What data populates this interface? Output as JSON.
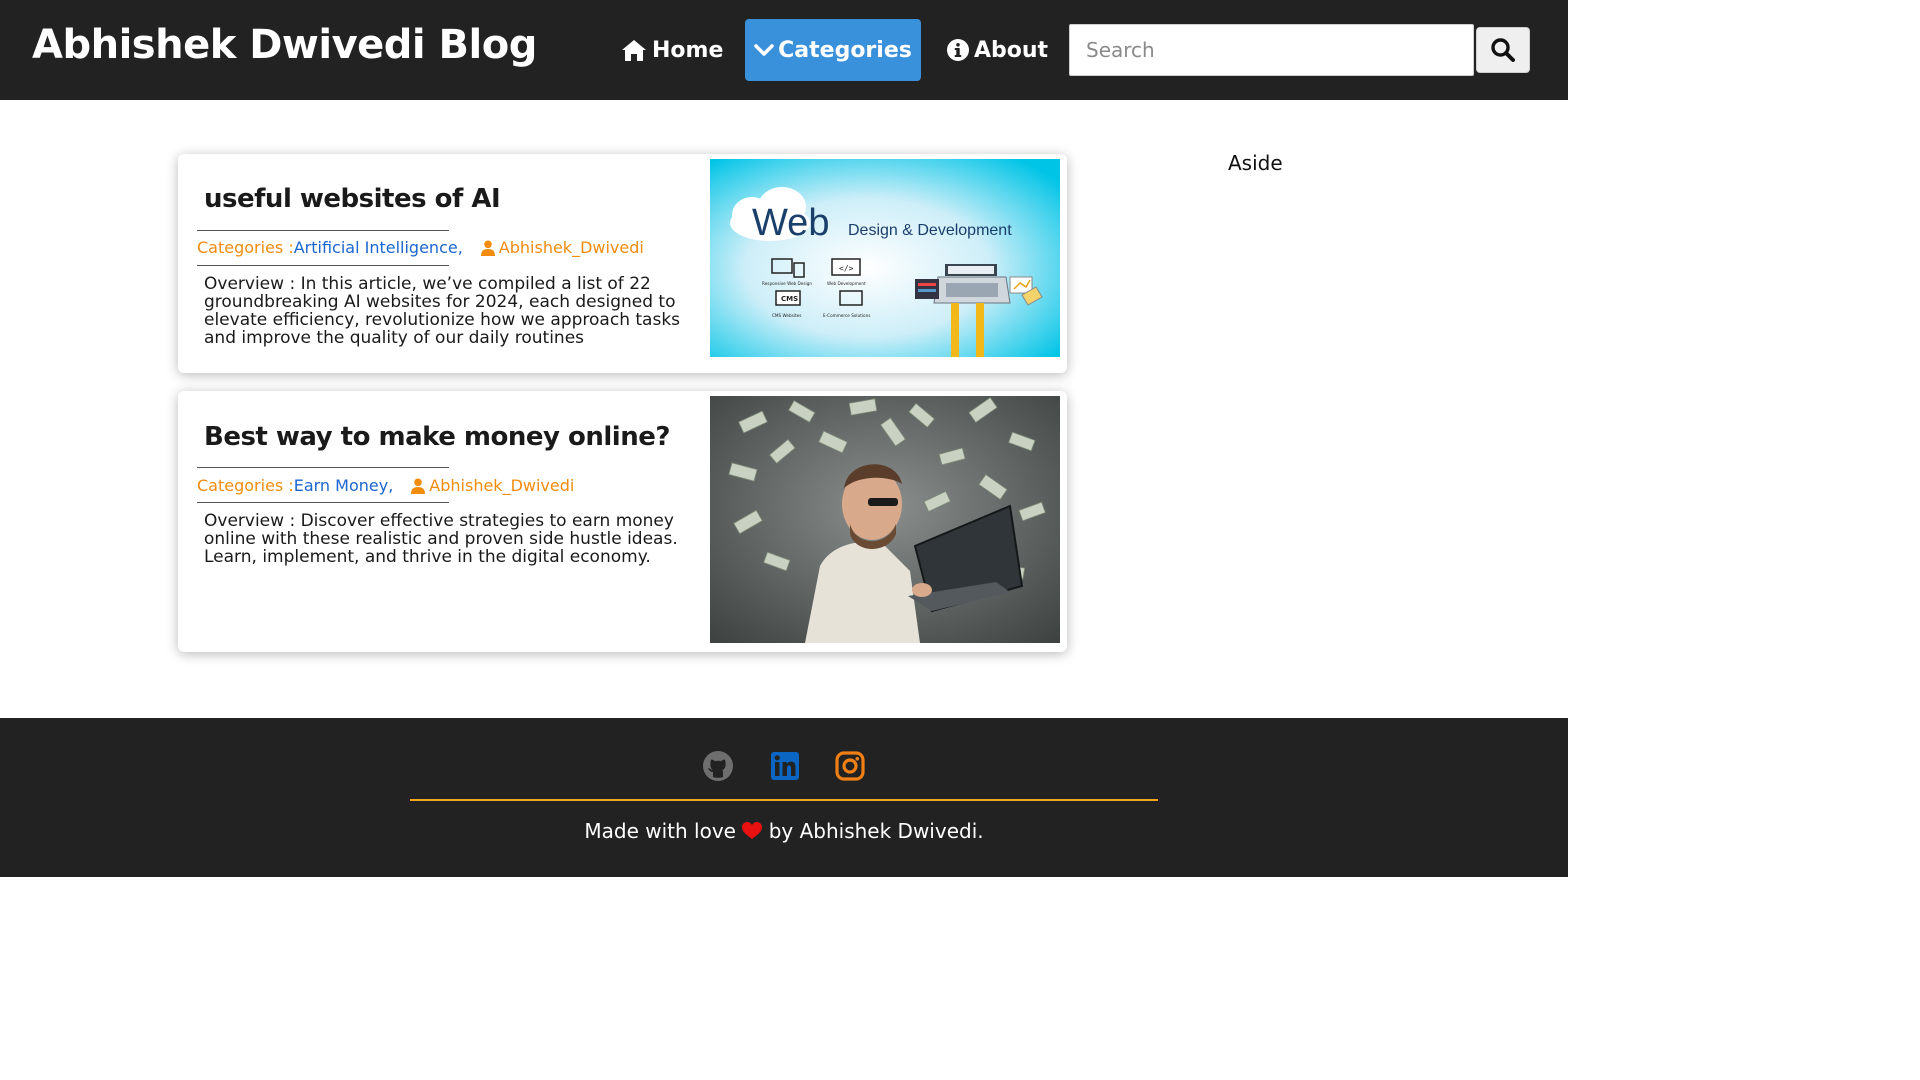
{
  "header": {
    "brand": "Abhishek Dwivedi Blog",
    "nav": {
      "home": "Home",
      "categories": "Categories",
      "about": "About"
    },
    "search_placeholder": "Search"
  },
  "posts": [
    {
      "title": "useful websites of AI",
      "categories_label": "Categories :",
      "category": "Artificial Intelligence,",
      "author": "Abhishek_Dwivedi",
      "overview": "Overview : In this article, we’ve compiled a list of 22 groundbreaking AI websites for 2024, each designed to elevate efficiency, revolutionize how we approach tasks and improve the quality of our daily routines",
      "image": {
        "heading": "Web",
        "subheading": "Design & Development",
        "labels": [
          "Responsive Web Design",
          "Web Development",
          "CMS Websites",
          "E-Commerce Solutions"
        ],
        "cms_text": "CMS",
        "code_text": "</>"
      }
    },
    {
      "title": "Best way to make money online?",
      "categories_label": "Categories :",
      "category": "Earn Money,",
      "author": "Abhishek_Dwivedi",
      "overview": "Overview : Discover effective strategies to earn money online with these realistic and proven side hustle ideas. Learn, implement, and thrive in the digital economy."
    }
  ],
  "aside": "Aside",
  "footer": {
    "credit_before": "Made with love",
    "credit_after": "by Abhishek Dwivedi.",
    "icons": [
      "github-icon",
      "linkedin-icon",
      "instagram-icon",
      "heart-icon"
    ]
  },
  "colors": {
    "header_bg": "#222222",
    "active_nav": "#3a91db",
    "meta_orange": "#f28c0f",
    "link_blue": "#1a66d0",
    "footer_rule": "#f0a91f",
    "linkedin_blue": "#0a66c2",
    "instagram_orange": "#f07f14",
    "heart_red": "#e81010"
  }
}
